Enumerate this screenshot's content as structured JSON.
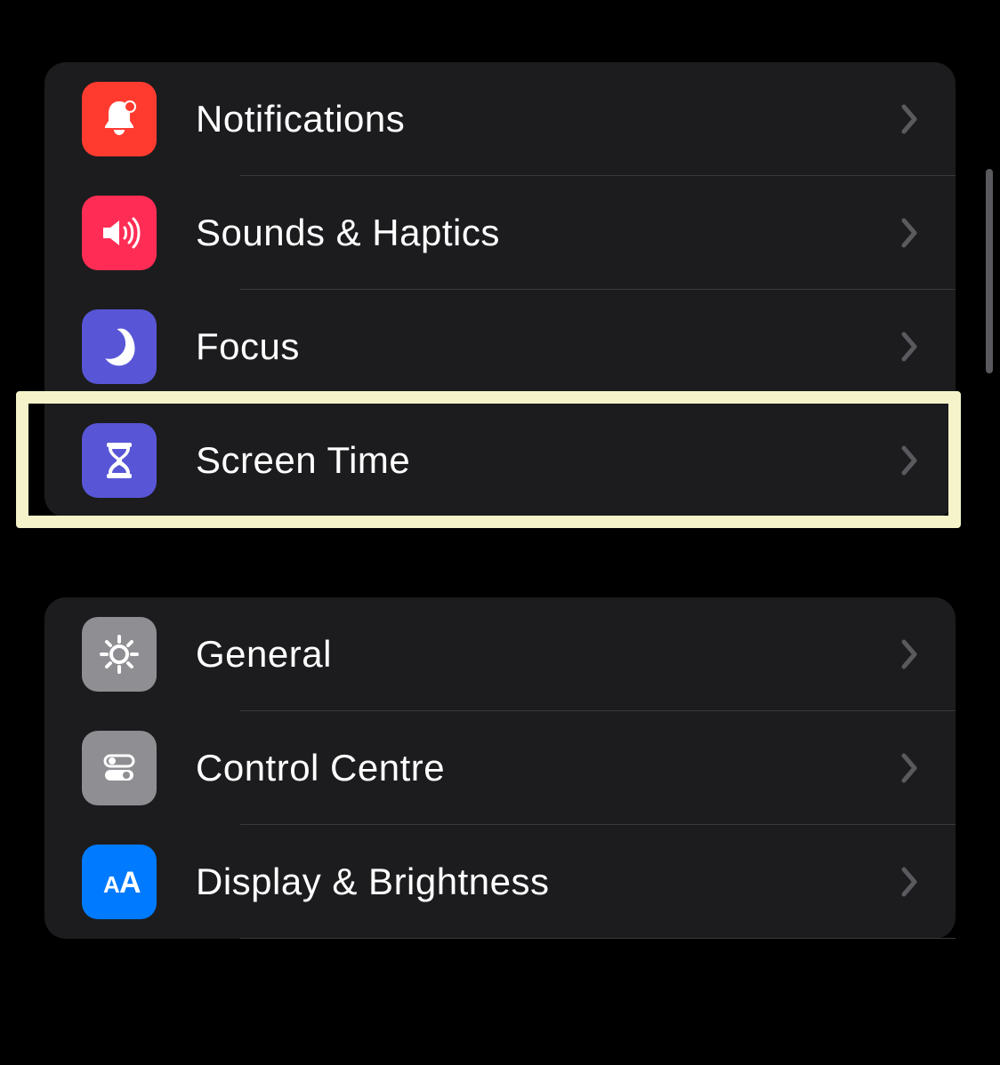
{
  "sections": [
    {
      "rows": [
        {
          "id": "notifications",
          "label": "Notifications",
          "icon": "bell-badge-icon",
          "icon_color": "#ff3b30",
          "highlighted": false
        },
        {
          "id": "sounds-haptics",
          "label": "Sounds & Haptics",
          "icon": "speaker-wave-icon",
          "icon_color": "#ff2d55",
          "highlighted": false
        },
        {
          "id": "focus",
          "label": "Focus",
          "icon": "moon-icon",
          "icon_color": "#5856d6",
          "highlighted": false
        },
        {
          "id": "screen-time",
          "label": "Screen Time",
          "icon": "hourglass-icon",
          "icon_color": "#5856d6",
          "highlighted": true
        }
      ]
    },
    {
      "rows": [
        {
          "id": "general",
          "label": "General",
          "icon": "gear-icon",
          "icon_color": "#8e8e93",
          "highlighted": false
        },
        {
          "id": "control-centre",
          "label": "Control Centre",
          "icon": "toggles-icon",
          "icon_color": "#8e8e93",
          "highlighted": false
        },
        {
          "id": "display-brightness",
          "label": "Display & Brightness",
          "icon": "text-size-icon",
          "icon_color": "#007aff",
          "highlighted": false
        }
      ]
    }
  ],
  "highlight_color": "#f4f3ca"
}
